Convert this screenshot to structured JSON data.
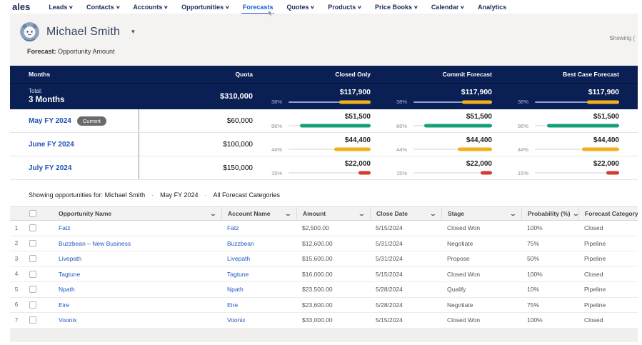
{
  "colors": {
    "navy": "#0a1f53",
    "accent_blue": "#1b5ed6",
    "link_blue": "#1f52b5",
    "bar_yellow": "#f2b11c",
    "bar_teal": "#15a07b",
    "bar_red": "#d63b2f",
    "dark_track": "#8fa0cf",
    "light_track": "#e9e9e9"
  },
  "nav": {
    "logo": "ales",
    "items": [
      {
        "label": "Leads",
        "caret": true,
        "active": false
      },
      {
        "label": "Contacts",
        "caret": true,
        "active": false
      },
      {
        "label": "Accounts",
        "caret": true,
        "active": false
      },
      {
        "label": "Opportunities",
        "caret": true,
        "active": false
      },
      {
        "label": "Forecasts",
        "caret": false,
        "active": true
      },
      {
        "label": "Quotes",
        "caret": true,
        "active": false
      },
      {
        "label": "Products",
        "caret": true,
        "active": false
      },
      {
        "label": "Price Books",
        "caret": true,
        "active": false
      },
      {
        "label": "Calendar",
        "caret": true,
        "active": false
      },
      {
        "label": "Analytics",
        "caret": false,
        "active": false
      }
    ]
  },
  "header": {
    "user_name": "Michael Smith",
    "user_caret": "▾",
    "showing_label": "Showing (",
    "forecast_label": "Forecast:",
    "forecast_value": " Opportunity Amount"
  },
  "forecast_table": {
    "columns": [
      "Months",
      "Quota",
      "Closed Only",
      "Commit Forecast",
      "Best Case Forecast"
    ],
    "total_row": {
      "label_small": "Total:",
      "label_big": "3 Months",
      "quota": "$310,000",
      "pct": "38%",
      "pct_num": 38,
      "value": "$117,900",
      "bar_color": "#f2b11c"
    },
    "month_rows": [
      {
        "month": "May FY 2024",
        "badge": "Current",
        "quota": "$60,000",
        "pct": "86%",
        "pct_num": 86,
        "value": "$51,500",
        "bar_color": "#15a07b"
      },
      {
        "month": "June FY 2024",
        "badge": "",
        "quota": "$100,000",
        "pct": "44%",
        "pct_num": 44,
        "value": "$44,400",
        "bar_color": "#f2b11c"
      },
      {
        "month": "July FY 2024",
        "badge": "",
        "quota": "$150,000",
        "pct": "15%",
        "pct_num": 15,
        "value": "$22,000",
        "bar_color": "#d63b2f"
      }
    ]
  },
  "opportunities": {
    "filter": {
      "prefix": "Showing opportunities for: Michael Smith",
      "separator": "·",
      "period": "May FY 2024",
      "category": "All Forecast Categories"
    },
    "columns": [
      "Opportunity Name",
      "Account Name",
      "Amount",
      "Close Date",
      "Stage",
      "Probability (%)",
      "Forecast Category"
    ],
    "rows": [
      {
        "num": "1",
        "opportunity": "Fatz",
        "account": "Fatz",
        "amount": "$2,500.00",
        "close_date": "5/15/2024",
        "stage": "Closed Won",
        "probability": "100%",
        "category": "Closed"
      },
      {
        "num": "2",
        "opportunity": "Buzzbean – New Business",
        "account": "Buzzbean",
        "amount": "$12,600.00",
        "close_date": "5/31/2024",
        "stage": "Negotiate",
        "probability": "75%",
        "category": "Pipeline"
      },
      {
        "num": "3",
        "opportunity": "Livepath",
        "account": "Livepath",
        "amount": "$15,600.00",
        "close_date": "5/31/2024",
        "stage": "Propose",
        "probability": "50%",
        "category": "Pipeline"
      },
      {
        "num": "4",
        "opportunity": "Tagtune",
        "account": "Tagtune",
        "amount": "$16,000.00",
        "close_date": "5/15/2024",
        "stage": "Closed Won",
        "probability": "100%",
        "category": "Closed"
      },
      {
        "num": "5",
        "opportunity": "Npath",
        "account": "Npath",
        "amount": "$23,500.00",
        "close_date": "5/28/2024",
        "stage": "Qualify",
        "probability": "10%",
        "category": "Pipeline"
      },
      {
        "num": "6",
        "opportunity": "Eire",
        "account": "Eire",
        "amount": "$23,600.00",
        "close_date": "5/28/2024",
        "stage": "Negotiate",
        "probability": "75%",
        "category": "Pipeline"
      },
      {
        "num": "7",
        "opportunity": "Voonix",
        "account": "Voonix",
        "amount": "$33,000.00",
        "close_date": "5/15/2024",
        "stage": "Closed Won",
        "probability": "100%",
        "category": "Closed"
      }
    ]
  }
}
